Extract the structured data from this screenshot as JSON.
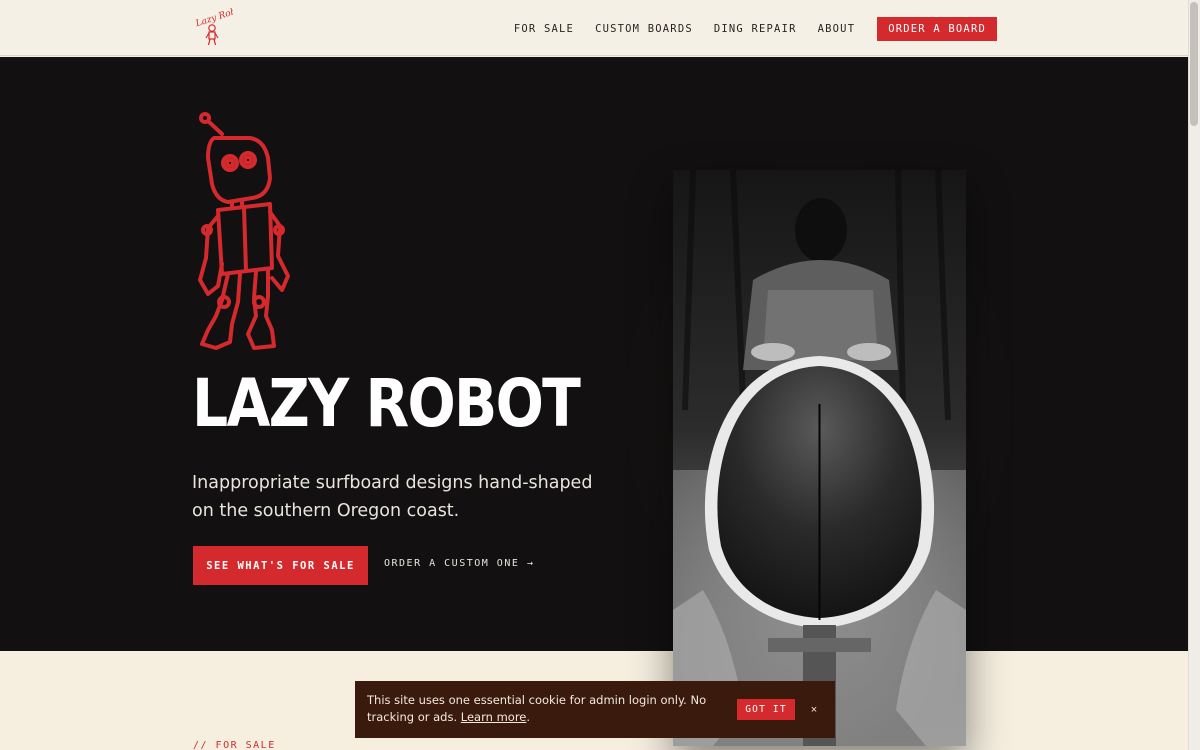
{
  "brand": {
    "logo_text": "Lazy Robot"
  },
  "nav": {
    "items": [
      "FOR SALE",
      "CUSTOM BOARDS",
      "DING REPAIR",
      "ABOUT"
    ],
    "order_label": "ORDER A BOARD"
  },
  "hero": {
    "title": "LAZY ROBOT",
    "tagline": "Inappropriate surfboard designs hand-shaped on the southern Oregon coast.",
    "primary_cta": "SEE WHAT'S FOR SALE",
    "secondary_cta": "ORDER A CUSTOM ONE →"
  },
  "section": {
    "label": "// FOR SALE"
  },
  "cookie": {
    "message": "This site uses one essential cookie for admin login only. No tracking or ads.",
    "link_text": "Learn more",
    "accept_label": "GOT IT",
    "close_label": "×"
  },
  "colors": {
    "accent": "#d42a2e",
    "hero_bg": "#121010",
    "header_bg": "#f5f0e6",
    "cookie_bg": "#3a1a0c"
  }
}
